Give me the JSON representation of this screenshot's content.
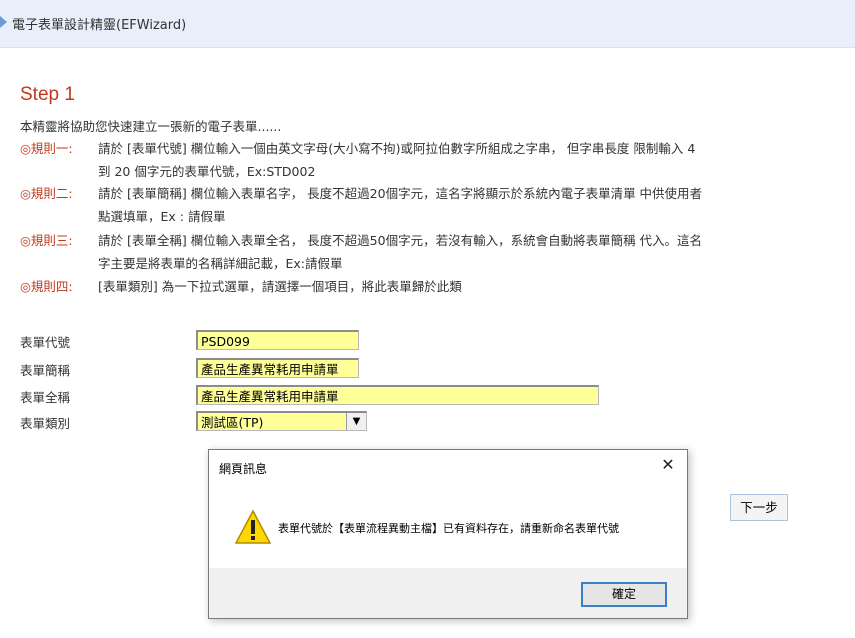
{
  "header": {
    "title": "電子表單設計精靈(EFWizard)"
  },
  "step": {
    "title": "Step 1",
    "intro": "本精靈將協助您快速建立一張新的電子表單......"
  },
  "rules": [
    {
      "tag": "◎規則一:",
      "line1": "請於 [表單代號] 欄位輸入一個由英文字母(大小寫不拘)或阿拉伯數字所組成之字串， 但字串長度 限制輸入 4",
      "line2": "到 20 個字元的表單代號，Ex:STD002"
    },
    {
      "tag": "◎規則二:",
      "line1": "請於 [表單簡稱] 欄位輸入表單名字， 長度不超過20個字元，這名字將顯示於系統內電子表單清單 中供使用者",
      "line2": "點選填單，Ex : 請假單"
    },
    {
      "tag": "◎規則三:",
      "line1": "請於 [表單全稱] 欄位輸入表單全名， 長度不超過50個字元，若沒有輸入，系統會自動將表單簡稱 代入。這名",
      "line2": "字主要是將表單的名稱詳細記載，Ex:請假單"
    },
    {
      "tag": "◎規則四:",
      "line1": "[表單類別] 為一下拉式選單，請選擇一個項目，將此表單歸於此類",
      "line2": ""
    }
  ],
  "form": {
    "code_label": "表單代號",
    "code_value": "PSD099",
    "short_label": "表單簡稱",
    "short_value": "產品生產異常耗用申請單",
    "full_label": "表單全稱",
    "full_value": "產品生產異常耗用申請單",
    "category_label": "表單類別",
    "category_value": "測試區(TP)"
  },
  "next_button": "下一步",
  "dialog": {
    "title": "網頁訊息",
    "close_glyph": "✕",
    "message": "表單代號於【表單流程異動主檔】已有資料存在，請重新命名表單代號",
    "ok_label": "確定"
  },
  "colors": {
    "accent_red": "#c0391b",
    "field_yellow": "#ffff99",
    "header_bg": "#e8effa"
  }
}
